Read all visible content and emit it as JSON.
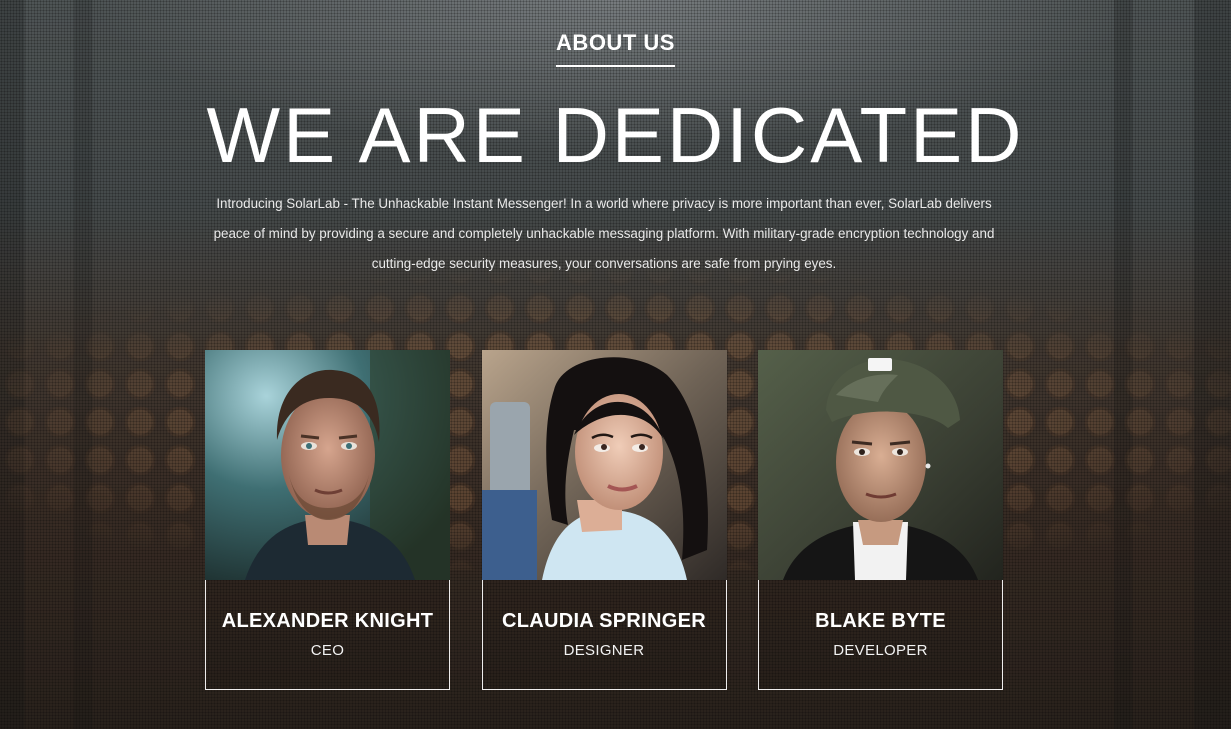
{
  "section": {
    "label": "ABOUT US",
    "headline": "WE ARE DEDICATED",
    "intro": "Introducing SolarLab - The Unhackable Instant Messenger! In a world where privacy is more important than ever, SolarLab delivers peace of mind by providing a secure and completely unhackable messaging platform. With military-grade encryption technology and cutting-edge security measures, your conversations are safe from prying eyes."
  },
  "team": [
    {
      "name": "ALEXANDER KNIGHT",
      "role": "CEO"
    },
    {
      "name": "CLAUDIA SPRINGER",
      "role": "DESIGNER"
    },
    {
      "name": "BLAKE BYTE",
      "role": "DEVELOPER"
    }
  ],
  "colors": {
    "text": "#ffffff",
    "card_border": "#ffffff",
    "background_top": "#5b6263",
    "background_bottom": "#2d241d"
  }
}
